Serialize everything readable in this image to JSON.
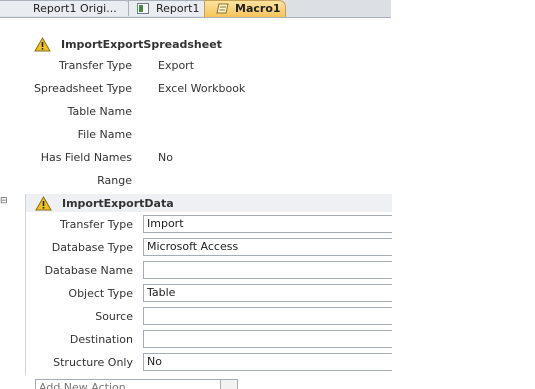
{
  "tabs": [
    {
      "label": "Report1 Origi...",
      "icon": "report-icon"
    },
    {
      "label": "Report1",
      "icon": "report-icon"
    },
    {
      "label": "Macro1",
      "icon": "macro-icon",
      "active": true
    }
  ],
  "actions": [
    {
      "name": "ImportExportSpreadsheet",
      "icon": "warning-icon",
      "arguments": [
        {
          "label": "Transfer Type",
          "value": "Export"
        },
        {
          "label": "Spreadsheet Type",
          "value": "Excel Workbook"
        },
        {
          "label": "Table Name",
          "value": ""
        },
        {
          "label": "File Name",
          "value": ""
        },
        {
          "label": "Has Field Names",
          "value": "No"
        },
        {
          "label": "Range",
          "value": ""
        }
      ]
    },
    {
      "name": "ImportExportData",
      "icon": "warning-icon",
      "collapse_glyph": "⊟",
      "arguments": [
        {
          "label": "Transfer Type",
          "value": "Import"
        },
        {
          "label": "Database Type",
          "value": "Microsoft Access"
        },
        {
          "label": "Database Name",
          "value": ""
        },
        {
          "label": "Object Type",
          "value": "Table"
        },
        {
          "label": "Source",
          "value": ""
        },
        {
          "label": "Destination",
          "value": ""
        },
        {
          "label": "Structure Only",
          "value": "No"
        }
      ]
    }
  ],
  "add_new_action": {
    "placeholder": "Add New Action"
  },
  "colors": {
    "active_tab": "#f6c457",
    "warning": "#f2c21b",
    "input_border": "#a6acb3"
  }
}
